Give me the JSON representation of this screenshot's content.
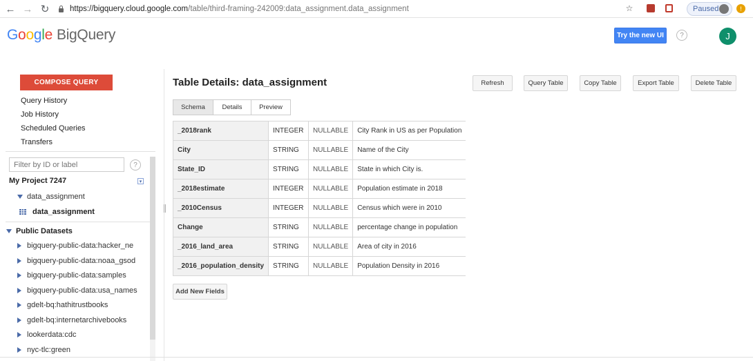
{
  "browser": {
    "url_host": "https://bigquery.cloud.google.com",
    "url_path": "/table/third-framing-242009:data_assignment.data_assignment",
    "paused_label": "Paused"
  },
  "header": {
    "logo_letters": [
      "G",
      "o",
      "o",
      "g",
      "l",
      "e"
    ],
    "product": "BigQuery",
    "try_new_ui_label": "Try the new UI",
    "help_label": "?",
    "user_initial": "J"
  },
  "sidebar": {
    "compose_label": "COMPOSE QUERY",
    "links": [
      "Query History",
      "Job History",
      "Scheduled Queries",
      "Transfers"
    ],
    "filter_placeholder": "Filter by ID or label",
    "help_label": "?",
    "project_title": "My Project 7247",
    "dataset": "data_assignment",
    "table": "data_assignment",
    "public_title": "Public Datasets",
    "public_items": [
      "bigquery-public-data:hacker_ne",
      "bigquery-public-data:noaa_gsod",
      "bigquery-public-data:samples",
      "bigquery-public-data:usa_names",
      "gdelt-bq:hathitrustbooks",
      "gdelt-bq:internetarchivebooks",
      "lookerdata:cdc",
      "nyc-tlc:green"
    ]
  },
  "main": {
    "title": "Table Details: data_assignment",
    "actions": [
      "Refresh",
      "Query Table",
      "Copy Table",
      "Export Table",
      "Delete Table"
    ],
    "tabs": [
      "Schema",
      "Details",
      "Preview"
    ],
    "active_tab": "Schema",
    "schema": [
      {
        "name": "_2018rank",
        "type": "INTEGER",
        "mode": "NULLABLE",
        "description": "City Rank in US as per Population"
      },
      {
        "name": "City",
        "type": "STRING",
        "mode": "NULLABLE",
        "description": "Name of the City"
      },
      {
        "name": "State_ID",
        "type": "STRING",
        "mode": "NULLABLE",
        "description": "State in which City is."
      },
      {
        "name": "_2018estimate",
        "type": "INTEGER",
        "mode": "NULLABLE",
        "description": "Population estimate in 2018"
      },
      {
        "name": "_2010Census",
        "type": "INTEGER",
        "mode": "NULLABLE",
        "description": "Census which were in 2010"
      },
      {
        "name": "Change",
        "type": "STRING",
        "mode": "NULLABLE",
        "description": "percentage change in population"
      },
      {
        "name": "_2016_land_area",
        "type": "STRING",
        "mode": "NULLABLE",
        "description": "Area of city in 2016"
      },
      {
        "name": "_2016_population_density",
        "type": "STRING",
        "mode": "NULLABLE",
        "description": "Population Density in 2016"
      }
    ],
    "add_field_label": "Add New Fields"
  }
}
